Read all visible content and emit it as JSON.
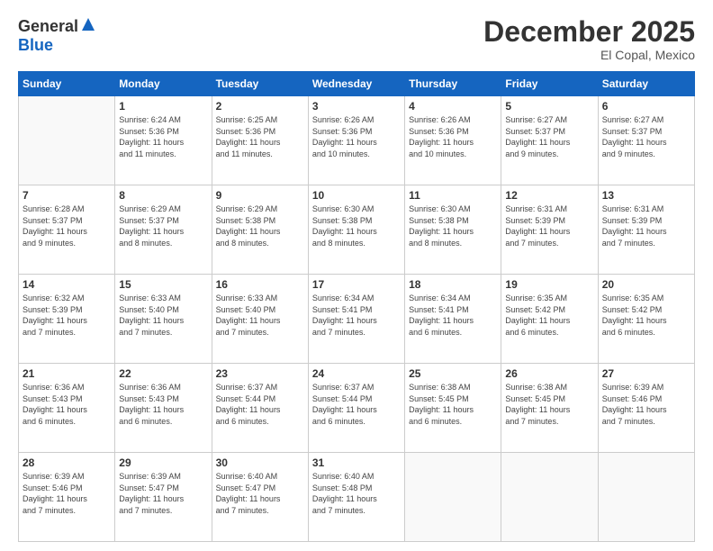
{
  "header": {
    "logo_general": "General",
    "logo_blue": "Blue",
    "month_title": "December 2025",
    "subtitle": "El Copal, Mexico"
  },
  "days_of_week": [
    "Sunday",
    "Monday",
    "Tuesday",
    "Wednesday",
    "Thursday",
    "Friday",
    "Saturday"
  ],
  "weeks": [
    [
      {
        "day": "",
        "info": ""
      },
      {
        "day": "1",
        "info": "Sunrise: 6:24 AM\nSunset: 5:36 PM\nDaylight: 11 hours\nand 11 minutes."
      },
      {
        "day": "2",
        "info": "Sunrise: 6:25 AM\nSunset: 5:36 PM\nDaylight: 11 hours\nand 11 minutes."
      },
      {
        "day": "3",
        "info": "Sunrise: 6:26 AM\nSunset: 5:36 PM\nDaylight: 11 hours\nand 10 minutes."
      },
      {
        "day": "4",
        "info": "Sunrise: 6:26 AM\nSunset: 5:36 PM\nDaylight: 11 hours\nand 10 minutes."
      },
      {
        "day": "5",
        "info": "Sunrise: 6:27 AM\nSunset: 5:37 PM\nDaylight: 11 hours\nand 9 minutes."
      },
      {
        "day": "6",
        "info": "Sunrise: 6:27 AM\nSunset: 5:37 PM\nDaylight: 11 hours\nand 9 minutes."
      }
    ],
    [
      {
        "day": "7",
        "info": "Sunrise: 6:28 AM\nSunset: 5:37 PM\nDaylight: 11 hours\nand 9 minutes."
      },
      {
        "day": "8",
        "info": "Sunrise: 6:29 AM\nSunset: 5:37 PM\nDaylight: 11 hours\nand 8 minutes."
      },
      {
        "day": "9",
        "info": "Sunrise: 6:29 AM\nSunset: 5:38 PM\nDaylight: 11 hours\nand 8 minutes."
      },
      {
        "day": "10",
        "info": "Sunrise: 6:30 AM\nSunset: 5:38 PM\nDaylight: 11 hours\nand 8 minutes."
      },
      {
        "day": "11",
        "info": "Sunrise: 6:30 AM\nSunset: 5:38 PM\nDaylight: 11 hours\nand 8 minutes."
      },
      {
        "day": "12",
        "info": "Sunrise: 6:31 AM\nSunset: 5:39 PM\nDaylight: 11 hours\nand 7 minutes."
      },
      {
        "day": "13",
        "info": "Sunrise: 6:31 AM\nSunset: 5:39 PM\nDaylight: 11 hours\nand 7 minutes."
      }
    ],
    [
      {
        "day": "14",
        "info": "Sunrise: 6:32 AM\nSunset: 5:39 PM\nDaylight: 11 hours\nand 7 minutes."
      },
      {
        "day": "15",
        "info": "Sunrise: 6:33 AM\nSunset: 5:40 PM\nDaylight: 11 hours\nand 7 minutes."
      },
      {
        "day": "16",
        "info": "Sunrise: 6:33 AM\nSunset: 5:40 PM\nDaylight: 11 hours\nand 7 minutes."
      },
      {
        "day": "17",
        "info": "Sunrise: 6:34 AM\nSunset: 5:41 PM\nDaylight: 11 hours\nand 7 minutes."
      },
      {
        "day": "18",
        "info": "Sunrise: 6:34 AM\nSunset: 5:41 PM\nDaylight: 11 hours\nand 6 minutes."
      },
      {
        "day": "19",
        "info": "Sunrise: 6:35 AM\nSunset: 5:42 PM\nDaylight: 11 hours\nand 6 minutes."
      },
      {
        "day": "20",
        "info": "Sunrise: 6:35 AM\nSunset: 5:42 PM\nDaylight: 11 hours\nand 6 minutes."
      }
    ],
    [
      {
        "day": "21",
        "info": "Sunrise: 6:36 AM\nSunset: 5:43 PM\nDaylight: 11 hours\nand 6 minutes."
      },
      {
        "day": "22",
        "info": "Sunrise: 6:36 AM\nSunset: 5:43 PM\nDaylight: 11 hours\nand 6 minutes."
      },
      {
        "day": "23",
        "info": "Sunrise: 6:37 AM\nSunset: 5:44 PM\nDaylight: 11 hours\nand 6 minutes."
      },
      {
        "day": "24",
        "info": "Sunrise: 6:37 AM\nSunset: 5:44 PM\nDaylight: 11 hours\nand 6 minutes."
      },
      {
        "day": "25",
        "info": "Sunrise: 6:38 AM\nSunset: 5:45 PM\nDaylight: 11 hours\nand 6 minutes."
      },
      {
        "day": "26",
        "info": "Sunrise: 6:38 AM\nSunset: 5:45 PM\nDaylight: 11 hours\nand 7 minutes."
      },
      {
        "day": "27",
        "info": "Sunrise: 6:39 AM\nSunset: 5:46 PM\nDaylight: 11 hours\nand 7 minutes."
      }
    ],
    [
      {
        "day": "28",
        "info": "Sunrise: 6:39 AM\nSunset: 5:46 PM\nDaylight: 11 hours\nand 7 minutes."
      },
      {
        "day": "29",
        "info": "Sunrise: 6:39 AM\nSunset: 5:47 PM\nDaylight: 11 hours\nand 7 minutes."
      },
      {
        "day": "30",
        "info": "Sunrise: 6:40 AM\nSunset: 5:47 PM\nDaylight: 11 hours\nand 7 minutes."
      },
      {
        "day": "31",
        "info": "Sunrise: 6:40 AM\nSunset: 5:48 PM\nDaylight: 11 hours\nand 7 minutes."
      },
      {
        "day": "",
        "info": ""
      },
      {
        "day": "",
        "info": ""
      },
      {
        "day": "",
        "info": ""
      }
    ]
  ]
}
